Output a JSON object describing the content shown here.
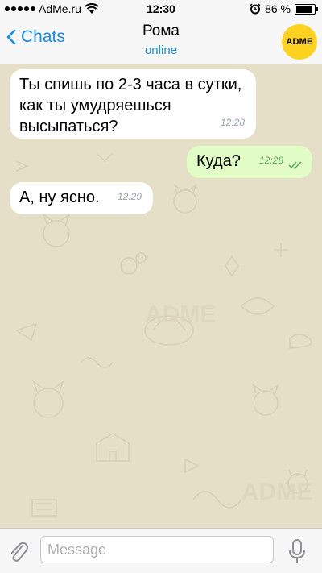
{
  "status_bar": {
    "carrier": "AdMe.ru",
    "time": "12:30",
    "battery": "86 %",
    "battery_level": 0.86
  },
  "nav": {
    "back_label": "Chats",
    "title": "Рома",
    "status": "online",
    "avatar_text": "ADME",
    "avatar_color": "#ffd21f"
  },
  "messages": [
    {
      "direction": "incoming",
      "text": "Ты спишь по 2-3 часа в сутки, как ты умудряешься высыпаться?",
      "time": "12:28"
    },
    {
      "direction": "outgoing",
      "text": "Куда?",
      "time": "12:28",
      "read": true
    },
    {
      "direction": "incoming",
      "text": "А, ну ясно.",
      "time": "12:29"
    }
  ],
  "input": {
    "placeholder": "Message"
  },
  "colors": {
    "accent": "#1a8ce8",
    "background": "#e5dfc7",
    "outgoing_bubble": "#e1fcc4",
    "incoming_bubble": "#ffffff"
  },
  "icons": {
    "back": "chevron-left-icon",
    "attach": "paperclip-icon",
    "mic": "microphone-icon",
    "read": "double-check-icon",
    "alarm": "alarm-clock-icon",
    "wifi": "wifi-icon",
    "battery": "battery-icon"
  }
}
